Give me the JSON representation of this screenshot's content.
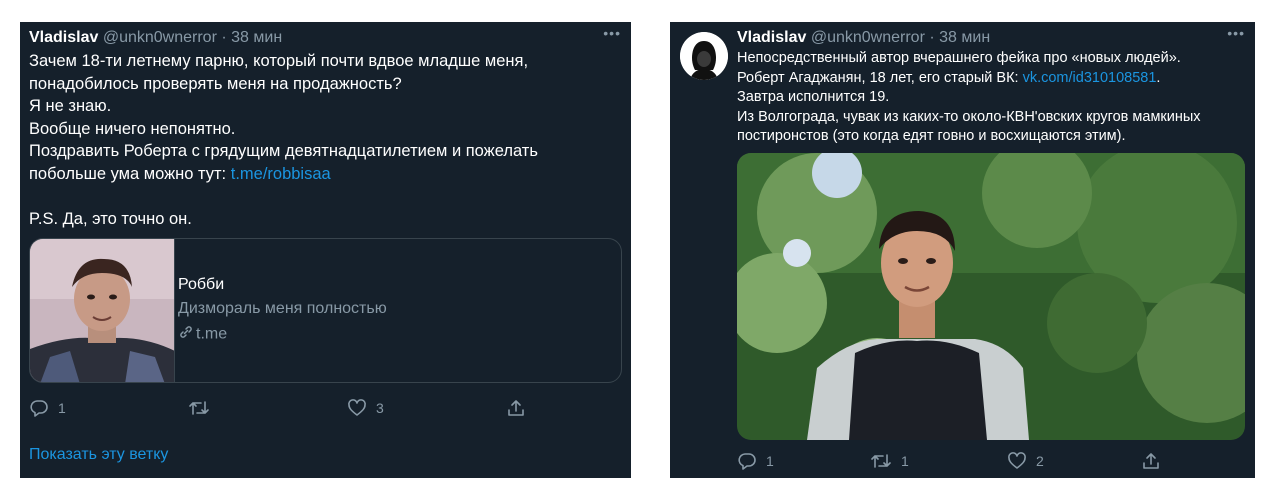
{
  "tweet1": {
    "name": "Vladislav",
    "handle": "@unkn0wnerror",
    "separator": "·",
    "time": "38 мин",
    "lines": [
      "Зачем 18-ти летнему парню, который почти вдвое младше меня,",
      "понадобилось проверять меня на продажность?",
      "Я не знаю.",
      "Вообще ничего непонятно.",
      "Поздравить Роберта с грядущим девятнадцатилетием и пожелать",
      "побольше ума можно тут: ",
      "P.S. Да, это точно он."
    ],
    "link": "t.me/robbisaa",
    "card": {
      "title": "Робби",
      "description": "Дизмораль меня полностью",
      "domain": "t.me"
    },
    "replies": "1",
    "retweets": "",
    "likes": "3",
    "show_thread": "Показать эту ветку"
  },
  "tweet2": {
    "name": "Vladislav",
    "handle": "@unkn0wnerror",
    "separator": "·",
    "time": "38 мин",
    "line1": "Непосредственный автор вчерашнего фейка про «новых людей».",
    "line2_prefix": "Роберт Агаджанян, 18 лет, его старый ВК: ",
    "line2_link": "vk.com/id310108581",
    "line2_suffix": ".",
    "line3": "Завтра исполнится 19.",
    "line4": "Из Волгограда, чувак из каких-то около-КВН'овских кругов мамкиных",
    "line5": "постиронстов (это когда едят говно и восхищаются этим).",
    "replies": "1",
    "retweets": "1",
    "likes": "2"
  },
  "icons": [
    "more-icon",
    "reply-icon",
    "retweet-icon",
    "like-icon",
    "share-icon",
    "link-icon",
    "avatar-icon"
  ],
  "colors": {
    "background": "#15202b",
    "secondary_text": "#8899a6",
    "link": "#1b95e0",
    "border": "#38444d"
  }
}
